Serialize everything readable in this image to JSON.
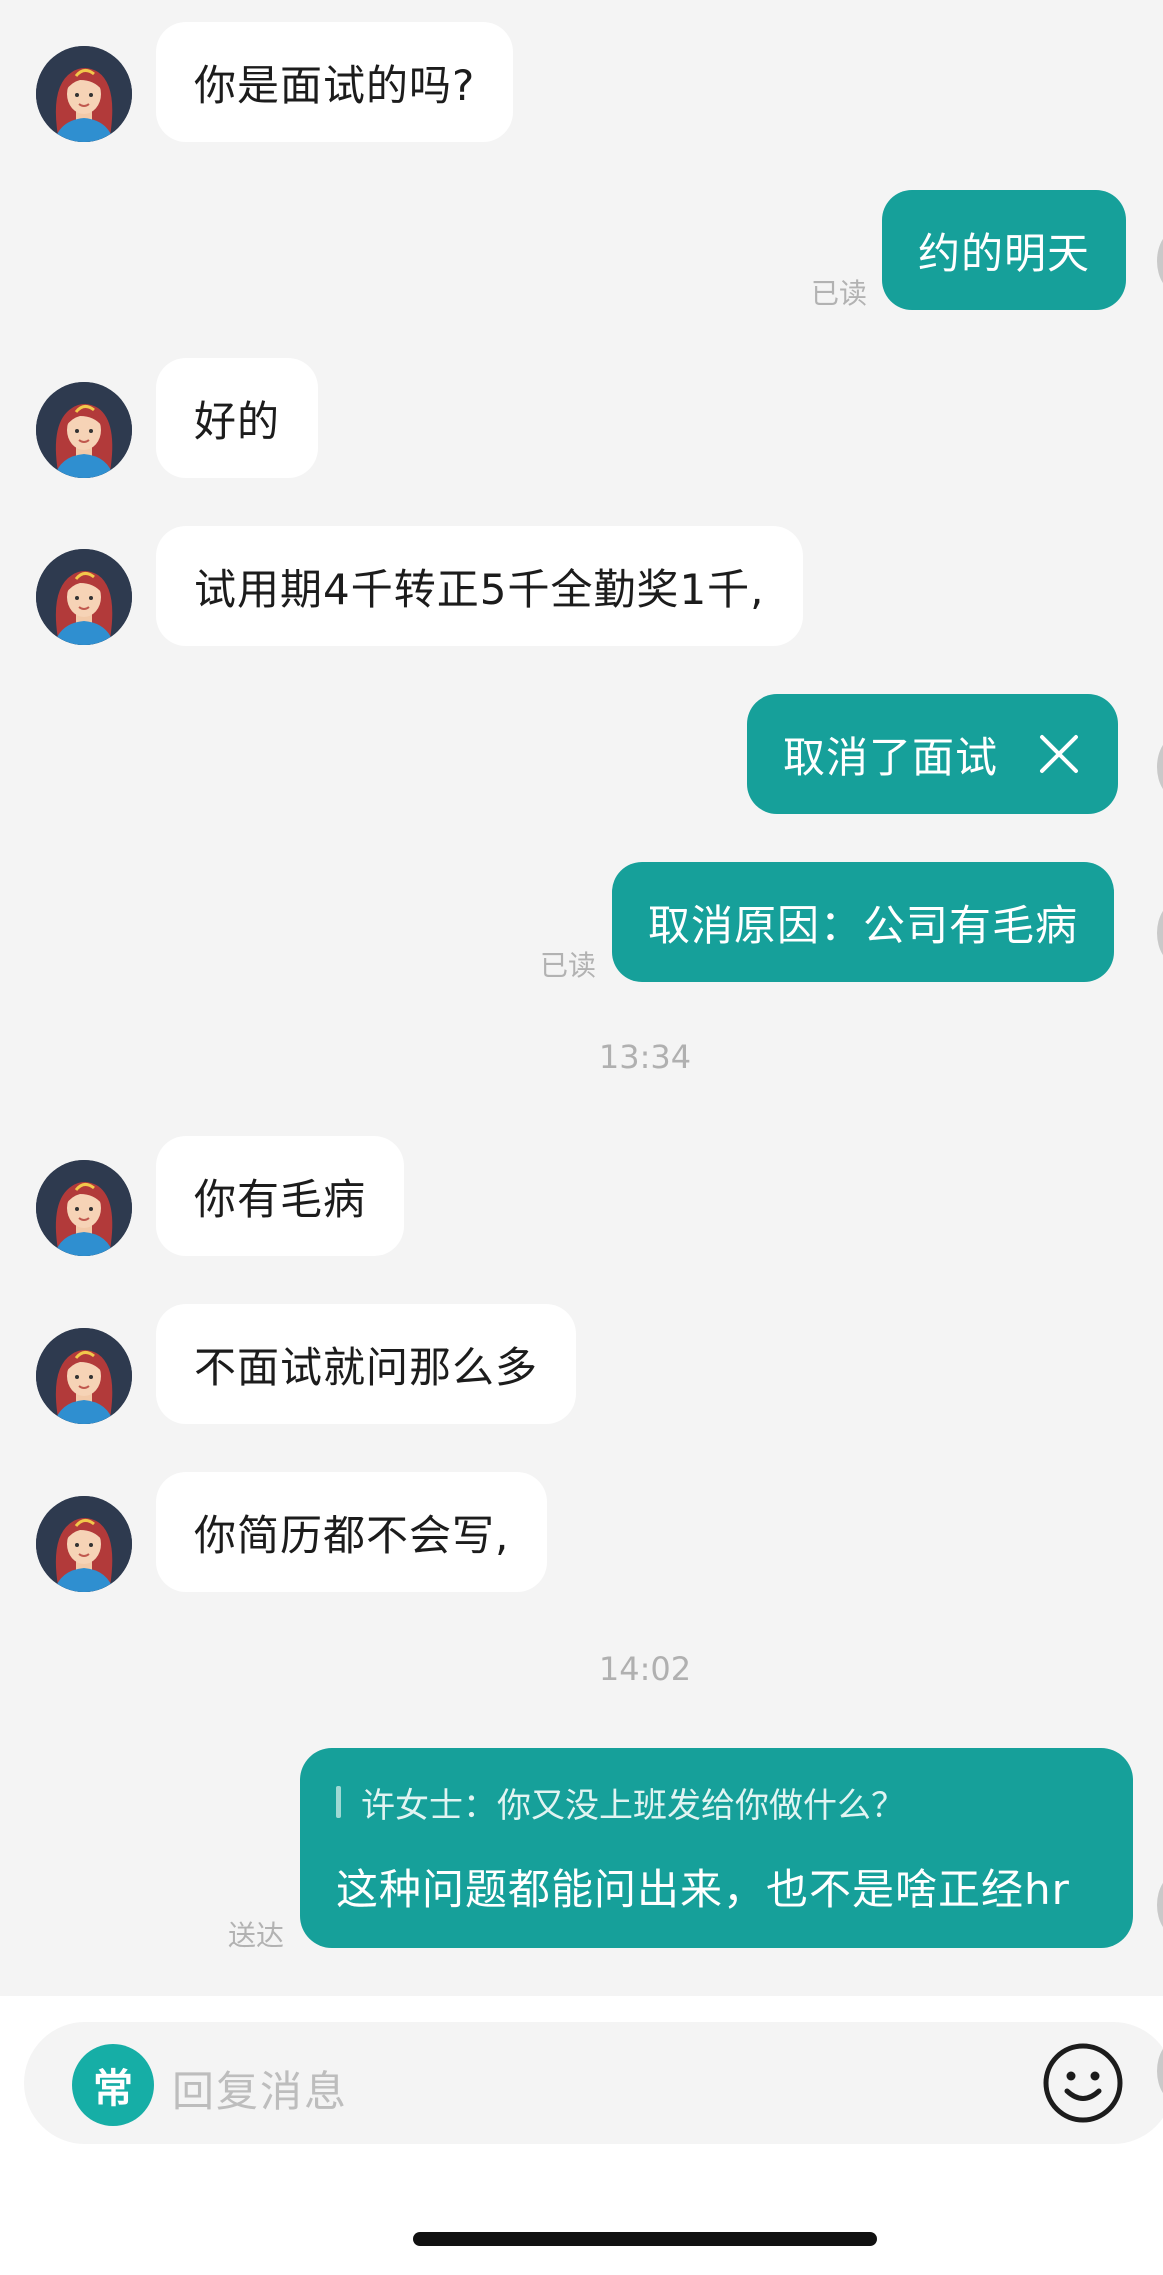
{
  "messages": [
    {
      "text": "你是面试的吗?"
    },
    {
      "text": "约的明天",
      "status": "已读"
    },
    {
      "text": "好的"
    },
    {
      "text": "试用期4千转正5千全勤奖1千,"
    },
    {
      "text": "取消了面试"
    },
    {
      "text": "取消原因：公司有毛病",
      "status": "已读"
    },
    {
      "time": "13:34"
    },
    {
      "text": "你有毛病"
    },
    {
      "text": "不面试就问那么多"
    },
    {
      "text": "你简历都不会写,"
    },
    {
      "time": "14:02"
    },
    {
      "quote": "许女士：你又没上班发给你做什么？",
      "text": "这种问题都能问出来，也不是啥正经hr",
      "status": "送达"
    }
  ],
  "input": {
    "quick_label": "常",
    "placeholder": "回复消息"
  },
  "colors": {
    "outgoing_bubble": "#16a09a",
    "incoming_bubble": "#ffffff",
    "background": "#f4f4f4"
  },
  "icons": [
    "contact-avatar",
    "close-icon",
    "emoji-icon"
  ]
}
